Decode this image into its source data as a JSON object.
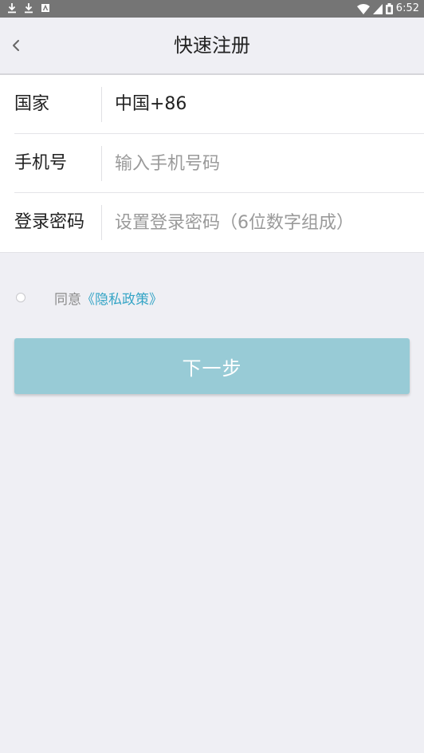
{
  "status_bar": {
    "time": "6:52",
    "bg_color": "#757575",
    "left_icons": [
      "download-icon",
      "download-icon",
      "notification-icon"
    ],
    "right_icons": [
      "wifi-icon",
      "signal-icon",
      "battery-icon"
    ]
  },
  "nav": {
    "title": "快速注册",
    "back_icon": "chevron-left-icon"
  },
  "form": {
    "country_label": "国家",
    "country_value": "中国+86",
    "phone_label": "手机号",
    "phone_placeholder": "输入手机号码",
    "password_label": "登录密码",
    "password_placeholder": "设置登录密码（6位数字组成）"
  },
  "agreement": {
    "prefix": "同意",
    "link": "《隐私政策》",
    "checked": false,
    "link_color": "#36a5c6"
  },
  "actions": {
    "next_label": "下一步",
    "next_bg_color": "#98cbd6"
  }
}
